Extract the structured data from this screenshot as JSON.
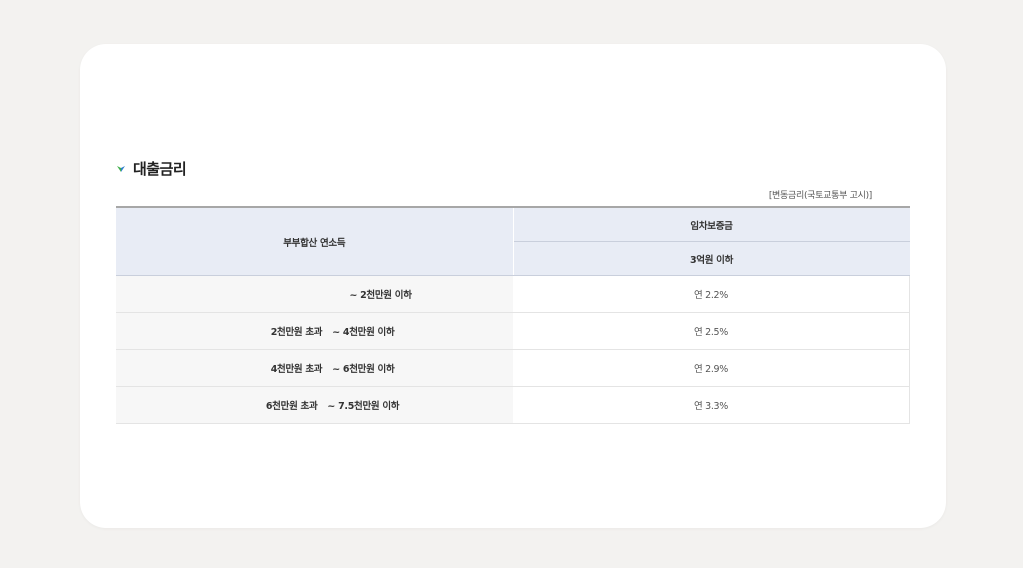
{
  "section": {
    "title": "대출금리"
  },
  "note": "[변동금리(국토교통부 고시)]",
  "table": {
    "header_income": "부부합산 연소득",
    "header_deposit": "임차보증금",
    "header_deposit_sub": "3억원 이하",
    "rows": [
      {
        "from": "",
        "to": "~ 2천만원 이하",
        "rate": "연 2.2%"
      },
      {
        "from": "2천만원 초과",
        "to": "~ 4천만원 이하",
        "rate": "연 2.5%"
      },
      {
        "from": "4천만원 초과",
        "to": "~ 6천만원 이하",
        "rate": "연 2.9%"
      },
      {
        "from": "6천만원 초과",
        "to": "~ 7.5천만원 이하",
        "rate": "연 3.3%"
      }
    ]
  },
  "colors": {
    "header_bg": "#e8ecf5",
    "income_bg": "#f7f7f7",
    "icon_green": "#3fae49",
    "icon_blue": "#2f7fc8"
  }
}
